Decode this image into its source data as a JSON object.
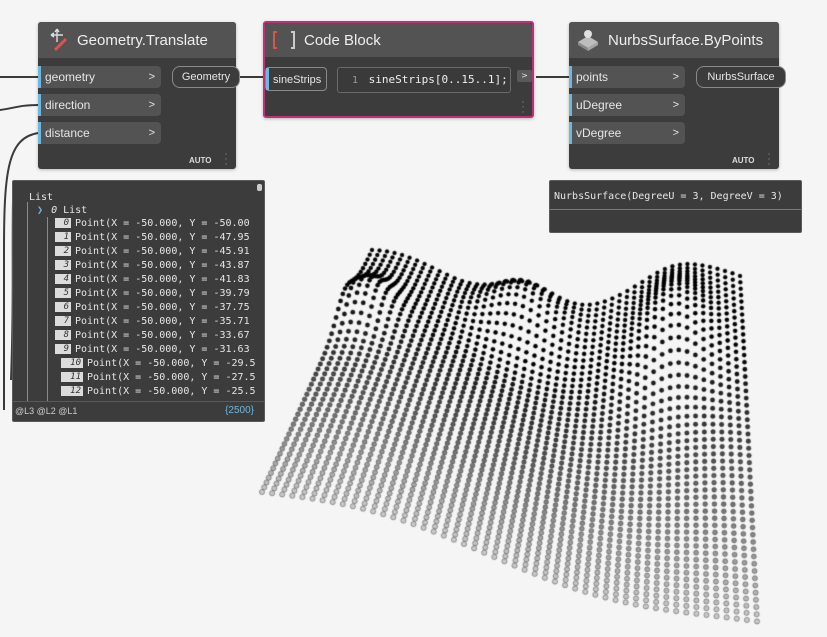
{
  "translate_node": {
    "title": "Geometry.Translate",
    "icon": "translate-icon",
    "inputs": [
      "geometry",
      "direction",
      "distance"
    ],
    "output": "Geometry",
    "lacing": "AUTO",
    "chevron": ">"
  },
  "code_block_node": {
    "title": "Code Block",
    "icon": "code-block-icon",
    "line_number": "1",
    "code": "sineStrips[0..15..1];",
    "output": "sineStrips",
    "output_chevron": ">"
  },
  "nurbs_node": {
    "title": "NurbsSurface.ByPoints",
    "icon": "nurbs-surface-icon",
    "inputs": [
      "points",
      "uDegree",
      "vDegree"
    ],
    "output": "NurbsSurface",
    "lacing": "AUTO",
    "chevron": ">",
    "preview_text": "NurbsSurface(DegreeU = 3, DegreeV = 3)"
  },
  "list_preview": {
    "root_label": "List",
    "sub_label": "List",
    "sub_index": "0",
    "rows": [
      {
        "i": "0",
        "text": "Point(X = -50.000, Y = -50.00"
      },
      {
        "i": "1",
        "text": "Point(X = -50.000, Y = -47.95"
      },
      {
        "i": "2",
        "text": "Point(X = -50.000, Y = -45.91"
      },
      {
        "i": "3",
        "text": "Point(X = -50.000, Y = -43.87"
      },
      {
        "i": "4",
        "text": "Point(X = -50.000, Y = -41.83"
      },
      {
        "i": "5",
        "text": "Point(X = -50.000, Y = -39.79"
      },
      {
        "i": "6",
        "text": "Point(X = -50.000, Y = -37.75"
      },
      {
        "i": "7",
        "text": "Point(X = -50.000, Y = -35.71"
      },
      {
        "i": "8",
        "text": "Point(X = -50.000, Y = -33.67"
      },
      {
        "i": "9",
        "text": "Point(X = -50.000, Y = -31.63"
      },
      {
        "i": "10",
        "text": "Point(X = -50.000, Y = -29.5"
      },
      {
        "i": "11",
        "text": "Point(X = -50.000, Y = -27.5"
      },
      {
        "i": "12",
        "text": "Point(X = -50.000, Y = -25.5"
      }
    ],
    "levels": "@L3 @L2 @L1",
    "count": "{2500}"
  },
  "colors": {
    "canvas": "#f5f5f5",
    "node_body": "#3c3c3c",
    "node_header": "#535353",
    "selected_border": "#c0307a",
    "port_accent": "#6fb7de",
    "wire": "#3a3a3a",
    "points": "#111111"
  }
}
